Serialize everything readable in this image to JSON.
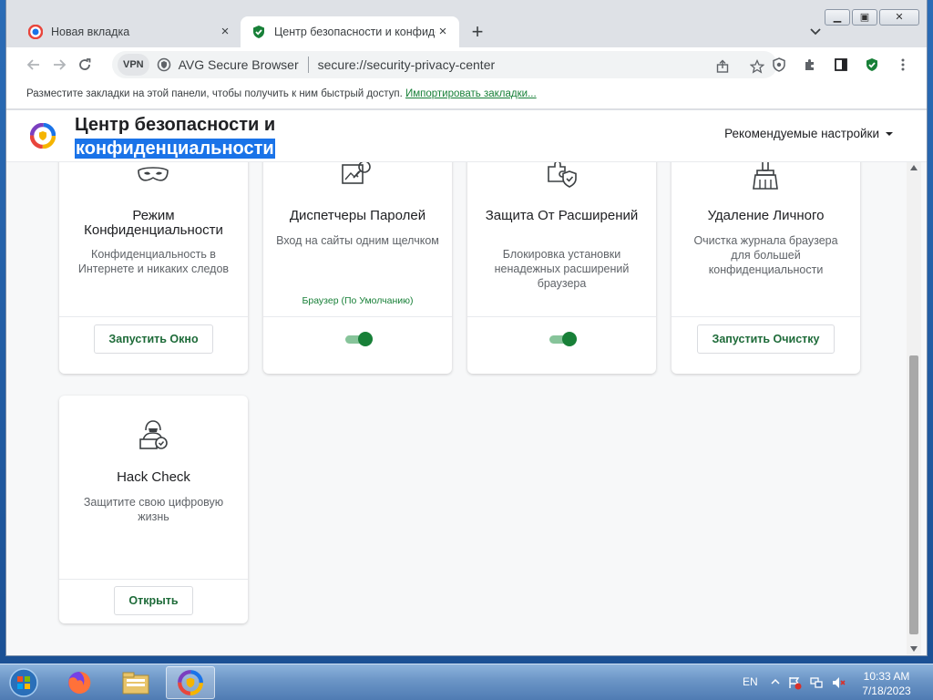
{
  "browser": {
    "tabs": [
      {
        "title": "Новая вкладка",
        "active": false
      },
      {
        "title": "Центр безопасности и конфиде",
        "active": true
      }
    ],
    "new_tab_label": "+",
    "close_glyph": "×",
    "vpn_label": "VPN",
    "brand_label": "AVG Secure Browser",
    "url": "secure://security-privacy-center",
    "bookmarks_text": "Разместите закладки на этой панели, чтобы получить к ним быстрый доступ.",
    "bookmarks_link": "Импортировать закладки..."
  },
  "page": {
    "title_line1": "Центр безопасности и",
    "title_line2": "конфиденциальности",
    "recommended_label": "Рекомендуемые настройки"
  },
  "cards": [
    {
      "title": "Режим Конфиденциальности",
      "desc": "Конфиденциальность в Интернете и никаких следов",
      "button": "Запустить Окно",
      "icon": "mask-icon"
    },
    {
      "title": "Диспетчеры Паролей",
      "desc": "Вход на сайты одним щелчком",
      "status": "Браузер (По Умолчанию)",
      "toggle": true,
      "icon": "password-key-icon"
    },
    {
      "title": "Защита От Расширений",
      "desc": "Блокировка установки ненадежных расширений браузера",
      "toggle": true,
      "icon": "puzzle-shield-icon"
    },
    {
      "title": "Удаление Личного",
      "desc": "Очистка журнала браузера для большей конфиденциальности",
      "button": "Запустить Очистку",
      "icon": "broom-icon"
    },
    {
      "title": "Hack Check",
      "desc": "Защитите свою цифровую жизнь",
      "button": "Открыть",
      "icon": "hacker-check-icon"
    }
  ],
  "taskbar": {
    "lang": "EN",
    "time": "10:33 AM",
    "date": "7/18/2023"
  },
  "colors": {
    "accent_green": "#188038",
    "selection_blue": "#1a73e8"
  }
}
